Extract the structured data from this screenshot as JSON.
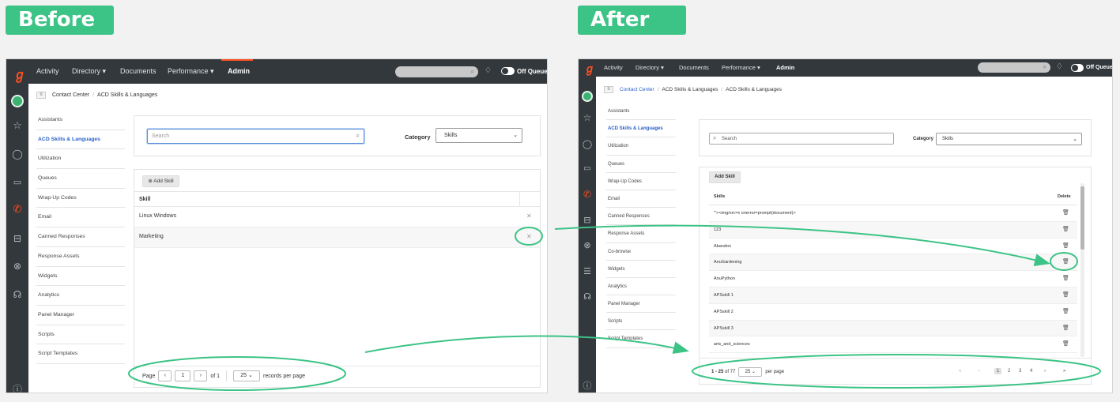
{
  "labels": {
    "before": "Before",
    "after": "After"
  },
  "colors": {
    "accent": "#3cc386",
    "brand": "#ff4f1f",
    "link": "#2a60c8",
    "topbar": "#33383d"
  },
  "nav": {
    "items": [
      "Activity",
      "Directory",
      "Documents",
      "Performance"
    ],
    "admin": "Admin",
    "off_queue": "Off Queue"
  },
  "icons": {
    "dropdown": "▾",
    "bell": "bell",
    "menu": "hamburger"
  },
  "before": {
    "breadcrumb": {
      "root": "Contact Center",
      "current": "ACD Skills & Languages"
    },
    "menu": [
      "Assistants",
      "ACD Skills & Languages",
      "Utilization",
      "Queues",
      "Wrap-Up Codes",
      "Email",
      "Canned Responses",
      "Response Assets",
      "Widgets",
      "Analytics",
      "Panel Manager",
      "Scripts",
      "Script Templates"
    ],
    "search_placeholder": "Search",
    "category_label": "Category",
    "category_value": "Skills",
    "add_button": "Add Skill",
    "column_header": "Skill",
    "rows": [
      "Linux Windows",
      "Marketing"
    ],
    "footer": {
      "page_label": "Page",
      "page_value": "1",
      "of_label": "of 1",
      "per_page_value": "25",
      "per_page_label": "records per page"
    }
  },
  "after": {
    "breadcrumb": {
      "root": "Contact Center",
      "middle": "ACD Skills & Languages",
      "current": "ACD Skills & Languages"
    },
    "menu": [
      "Assistants",
      "ACD Skills & Languages",
      "Utilization",
      "Queues",
      "Wrap-Up Codes",
      "Email",
      "Canned Responses",
      "Response Assets",
      "Co-browse",
      "Widgets",
      "Analytics",
      "Panel Manager",
      "Scripts",
      "Script Templates"
    ],
    "search_placeholder": "Search",
    "category_label": "Category",
    "category_value": "Skills",
    "add_button": "Add Skill",
    "column_header": "Skills",
    "delete_header": "Delete",
    "rows": [
      "\"'><img/src=x onerror=prompt(document)>",
      "123",
      "Abandon",
      "AnuGardening",
      "AnuPython",
      "APSskill 1",
      "APSskill 2",
      "APSskill 3",
      "arts_and_sciences"
    ],
    "footer": {
      "range_bold": "1 - 25",
      "range_rest": " of 77",
      "per_page_value": "25",
      "per_page_label": "per page",
      "pages": [
        "1",
        "2",
        "3",
        "4"
      ],
      "first": "«",
      "prev": "‹",
      "next": "›",
      "last": "»"
    }
  }
}
